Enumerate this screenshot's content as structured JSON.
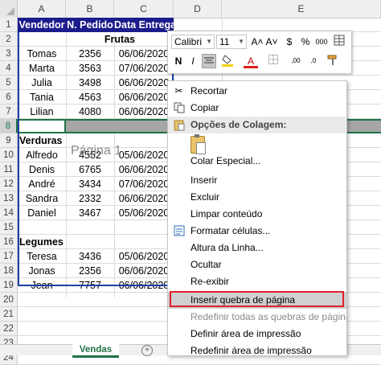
{
  "columns": [
    "A",
    "B",
    "C",
    "D",
    "E"
  ],
  "rows": [
    "1",
    "2",
    "3",
    "4",
    "5",
    "6",
    "7",
    "8",
    "9",
    "10",
    "11",
    "12",
    "13",
    "14",
    "15",
    "16",
    "17",
    "18",
    "19",
    "20",
    "21",
    "22",
    "23",
    "24"
  ],
  "header": {
    "vendedor": "Vendedor",
    "pedido": "N. Pedido",
    "data": "Data Entrega"
  },
  "groups": {
    "frutas": "Frutas",
    "verduras": "Verduras",
    "legumes": "Legumes"
  },
  "frutas_rows": [
    {
      "name": "Tomas",
      "num": "2356",
      "date": "06/06/2020"
    },
    {
      "name": "Marta",
      "num": "3563",
      "date": "07/06/2020"
    },
    {
      "name": "Julia",
      "num": "3498",
      "date": "06/06/2020"
    },
    {
      "name": "Tania",
      "num": "4563",
      "date": "06/06/2020"
    },
    {
      "name": "Lilian",
      "num": "4080",
      "date": "06/06/2020"
    }
  ],
  "verduras_rows": [
    {
      "name": "Alfredo",
      "num": "4552",
      "date": "05/06/2020"
    },
    {
      "name": "Denis",
      "num": "6765",
      "date": "06/06/2020"
    },
    {
      "name": "André",
      "num": "3434",
      "date": "07/06/2020"
    },
    {
      "name": "Sandra",
      "num": "2332",
      "date": "06/06/2020"
    },
    {
      "name": "Daniel",
      "num": "3467",
      "date": "05/06/2020"
    }
  ],
  "legumes_rows": [
    {
      "name": "Teresa",
      "num": "3436",
      "date": "05/06/2020"
    },
    {
      "name": "Jonas",
      "num": "2356",
      "date": "06/06/2020"
    },
    {
      "name": "Jean",
      "num": "7757",
      "date": "06/06/2020"
    }
  ],
  "watermark": "Página 1",
  "sheet_tab": "Vendas",
  "add_sheet_symbol": "+",
  "mini_toolbar": {
    "font": "Calibri",
    "size": "11",
    "grow_font": "A˄",
    "shrink_font": "A˅",
    "currency": "$",
    "percent": "%",
    "comma": "000",
    "bold": "N",
    "italic": "I",
    "font_color": "A",
    "decrease_decimal": ",00",
    "increase_decimal": ",0"
  },
  "menu": {
    "recortar": "Recortar",
    "copiar": "Copiar",
    "opcoes_colagem": "Opções de Colagem:",
    "colar_especial": "Colar Especial...",
    "inserir": "Inserir",
    "excluir": "Excluir",
    "limpar": "Limpar conteúdo",
    "formatar": "Formatar células...",
    "altura": "Altura da Linha...",
    "ocultar": "Ocultar",
    "reexibir": "Re-exibir",
    "inserir_quebra": "Inserir quebra de página",
    "redefinir_quebras": "Redefinir todas as quebras de página",
    "definir_area": "Definir área de impressão",
    "redefinir_area": "Redefinir área de impressão"
  },
  "colors": {
    "accent": "#217346",
    "header_fill": "#1c1c8c",
    "highlight_box": "#e0202a"
  }
}
